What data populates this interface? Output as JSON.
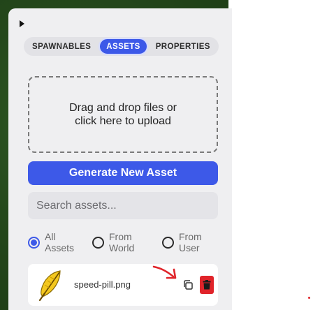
{
  "tabs": [
    {
      "label": "SPAWNABLES",
      "active": false
    },
    {
      "label": "ASSETS",
      "active": true
    },
    {
      "label": "PROPERTIES",
      "active": false
    }
  ],
  "upload": {
    "line1": "Drag and drop files or",
    "line2": "click here to upload"
  },
  "generate_label": "Generate New Asset",
  "search": {
    "placeholder": "Search assets...",
    "value": ""
  },
  "filters": [
    {
      "line1": "All",
      "line2": "Assets",
      "checked": true
    },
    {
      "line1": "From",
      "line2": "World",
      "checked": false
    },
    {
      "line1": "From",
      "line2": "User",
      "checked": false
    }
  ],
  "assets": [
    {
      "name": "speed-pill.png",
      "thumb_icon": "yellow-feather-icon"
    }
  ],
  "colors": {
    "accent": "#3d59e8",
    "danger": "#e0242a",
    "panel": "#efeff1"
  }
}
